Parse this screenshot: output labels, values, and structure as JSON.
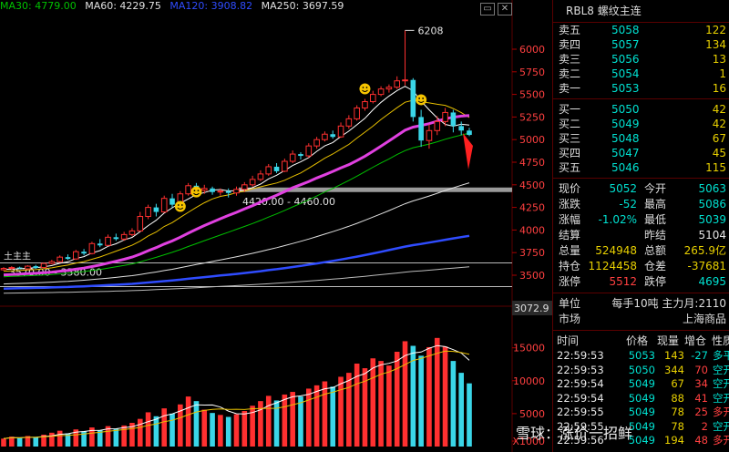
{
  "ma_legend": [
    {
      "label": "MA30: 4779.00",
      "color": "#00c000"
    },
    {
      "label": "MA60: 4229.75",
      "color": "#e0e0e0"
    },
    {
      "label": "MA120: 3908.82",
      "color": "#2f4cff"
    },
    {
      "label": "MA250: 3697.59",
      "color": "#e0e0e0"
    }
  ],
  "window_buttons": {
    "expand": "▭",
    "close": "✕"
  },
  "chart_labels": {
    "high": "6208",
    "band_upper": "4420.00 - 4460.00",
    "band_lower": "3570.00 - 3580.00",
    "price_tag": "3072.9",
    "watermark_left": "土主主"
  },
  "price_axis": [
    "6000",
    "5750",
    "5500",
    "5250",
    "5000",
    "4750",
    "4500",
    "4250",
    "4000",
    "3750",
    "3500"
  ],
  "volume_axis": [
    "15000",
    "10000",
    "5000",
    "X1000"
  ],
  "panel": {
    "title": "RBL8  螺纹主连",
    "asks": [
      {
        "label": "卖五",
        "price": "5058",
        "vol": "122"
      },
      {
        "label": "卖四",
        "price": "5057",
        "vol": "134"
      },
      {
        "label": "卖三",
        "price": "5056",
        "vol": "13"
      },
      {
        "label": "卖二",
        "price": "5054",
        "vol": "1"
      },
      {
        "label": "卖一",
        "price": "5053",
        "vol": "16"
      }
    ],
    "bids": [
      {
        "label": "买一",
        "price": "5050",
        "vol": "42"
      },
      {
        "label": "买二",
        "price": "5049",
        "vol": "42"
      },
      {
        "label": "买三",
        "price": "5048",
        "vol": "67"
      },
      {
        "label": "买四",
        "price": "5047",
        "vol": "45"
      },
      {
        "label": "买五",
        "price": "5046",
        "vol": "115"
      }
    ],
    "quote": [
      {
        "l1": "现价",
        "v1": "5052",
        "c1": "cyan",
        "l2": "今开",
        "v2": "5063",
        "c2": "cyan"
      },
      {
        "l1": "涨跌",
        "v1": "-52",
        "c1": "cyan",
        "l2": "最高",
        "v2": "5086",
        "c2": "cyan"
      },
      {
        "l1": "涨幅",
        "v1": "-1.02%",
        "c1": "cyan",
        "l2": "最低",
        "v2": "5039",
        "c2": "cyan"
      },
      {
        "l1": "结算",
        "v1": "",
        "c1": "white",
        "l2": "昨结",
        "v2": "5104",
        "c2": "white"
      },
      {
        "l1": "总量",
        "v1": "524948",
        "c1": "yellow",
        "l2": "总额",
        "v2": "265.9亿",
        "c2": "yellow"
      },
      {
        "l1": "持仓",
        "v1": "1124458",
        "c1": "yellow",
        "l2": "仓差",
        "v2": "-37681",
        "c2": "yellow"
      },
      {
        "l1": "涨停",
        "v1": "5512",
        "c1": "red",
        "l2": "跌停",
        "v2": "4695",
        "c2": "cyan"
      }
    ],
    "unit": {
      "label": "单位",
      "value": "每手10吨  主力月:2110"
    },
    "market": {
      "label": "市场",
      "value": "上海商品"
    },
    "ticks_header": [
      "时间",
      "价格",
      "现量",
      "增仓",
      "性质"
    ],
    "ticks": [
      {
        "time": "22:59:53",
        "price": "5053",
        "pc": "cyan",
        "vol": "143",
        "chg": "-27",
        "cc": "cyan",
        "nat": "多平",
        "nc": "cyan"
      },
      {
        "time": "22:59:53",
        "price": "5050",
        "pc": "cyan",
        "vol": "344",
        "chg": "70",
        "cc": "red",
        "nat": "空开",
        "nc": "cyan"
      },
      {
        "time": "22:59:54",
        "price": "5049",
        "pc": "cyan",
        "vol": "67",
        "chg": "34",
        "cc": "red",
        "nat": "空开",
        "nc": "cyan"
      },
      {
        "time": "22:59:54",
        "price": "5049",
        "pc": "cyan",
        "vol": "88",
        "chg": "41",
        "cc": "red",
        "nat": "空开",
        "nc": "cyan"
      },
      {
        "time": "22:59:55",
        "price": "5049",
        "pc": "cyan",
        "vol": "78",
        "chg": "25",
        "cc": "red",
        "nat": "多开",
        "nc": "red"
      },
      {
        "time": "22:59:55",
        "price": "5049",
        "pc": "cyan",
        "vol": "78",
        "chg": "2",
        "cc": "red",
        "nat": "空开",
        "nc": "cyan"
      },
      {
        "time": "22:59:56",
        "price": "5049",
        "pc": "cyan",
        "vol": "194",
        "chg": "48",
        "cc": "red",
        "nat": "多开",
        "nc": "red"
      }
    ]
  },
  "watermark": "雪球：涨价一招鲜",
  "chart_data": {
    "type": "candlestick",
    "y_axis": {
      "min": 3500,
      "max": 6000,
      "ticks": [
        3500,
        3750,
        4000,
        4250,
        4500,
        4750,
        5000,
        5250,
        5500,
        5750,
        6000
      ]
    },
    "high_label": 6208,
    "candles": [
      [
        3560,
        3575,
        3550,
        3590
      ],
      [
        3575,
        3585,
        3560,
        3600
      ],
      [
        3585,
        3575,
        3565,
        3595
      ],
      [
        3570,
        3600,
        3560,
        3610
      ],
      [
        3600,
        3580,
        3570,
        3615
      ],
      [
        3585,
        3630,
        3575,
        3640
      ],
      [
        3630,
        3650,
        3620,
        3670
      ],
      [
        3650,
        3700,
        3640,
        3720
      ],
      [
        3700,
        3680,
        3670,
        3730
      ],
      [
        3680,
        3760,
        3670,
        3780
      ],
      [
        3760,
        3740,
        3720,
        3790
      ],
      [
        3740,
        3850,
        3730,
        3870
      ],
      [
        3850,
        3830,
        3810,
        3900
      ],
      [
        3830,
        3920,
        3820,
        3950
      ],
      [
        3920,
        3900,
        3880,
        3960
      ],
      [
        3900,
        3950,
        3880,
        3980
      ],
      [
        3950,
        3990,
        3930,
        4020
      ],
      [
        3990,
        4150,
        3980,
        4200
      ],
      [
        4150,
        4250,
        4120,
        4280
      ],
      [
        4250,
        4200,
        4150,
        4290
      ],
      [
        4200,
        4350,
        4190,
        4380
      ],
      [
        4350,
        4280,
        4250,
        4400
      ],
      [
        4280,
        4400,
        4260,
        4430
      ],
      [
        4400,
        4490,
        4380,
        4520
      ],
      [
        4490,
        4440,
        4420,
        4520
      ],
      [
        4440,
        4460,
        4400,
        4500
      ],
      [
        4460,
        4420,
        4390,
        4480
      ],
      [
        4420,
        4430,
        4380,
        4460
      ],
      [
        4430,
        4410,
        4360,
        4460
      ],
      [
        4410,
        4450,
        4380,
        4480
      ],
      [
        4450,
        4500,
        4420,
        4530
      ],
      [
        4500,
        4560,
        4480,
        4600
      ],
      [
        4560,
        4620,
        4540,
        4660
      ],
      [
        4620,
        4700,
        4600,
        4730
      ],
      [
        4700,
        4650,
        4630,
        4740
      ],
      [
        4650,
        4760,
        4640,
        4790
      ],
      [
        4760,
        4840,
        4740,
        4880
      ],
      [
        4840,
        4820,
        4780,
        4860
      ],
      [
        4820,
        4930,
        4800,
        4960
      ],
      [
        4930,
        5000,
        4900,
        5030
      ],
      [
        5000,
        5060,
        4980,
        5090
      ],
      [
        5060,
        5030,
        5010,
        5100
      ],
      [
        5030,
        5150,
        5020,
        5190
      ],
      [
        5150,
        5230,
        5120,
        5270
      ],
      [
        5230,
        5350,
        5210,
        5380
      ],
      [
        5350,
        5420,
        5320,
        5450
      ],
      [
        5420,
        5500,
        5400,
        5540
      ],
      [
        5500,
        5560,
        5480,
        5590
      ],
      [
        5560,
        5580,
        5520,
        5610
      ],
      [
        5580,
        5650,
        5560,
        5700
      ],
      [
        5650,
        5660,
        5600,
        6208
      ],
      [
        5660,
        5250,
        5200,
        5680
      ],
      [
        5250,
        4990,
        4920,
        5330
      ],
      [
        4990,
        5100,
        4900,
        5170
      ],
      [
        5100,
        5200,
        5050,
        5260
      ],
      [
        5200,
        5300,
        5150,
        5350
      ],
      [
        5300,
        5150,
        5080,
        5330
      ],
      [
        5150,
        5100,
        5050,
        5200
      ],
      [
        5100,
        5052,
        5039,
        5130
      ]
    ],
    "volumes": [
      1200,
      1500,
      1300,
      1600,
      1400,
      1800,
      2100,
      2400,
      2000,
      2600,
      2300,
      2900,
      2500,
      3100,
      2700,
      3200,
      3600,
      4200,
      5200,
      4600,
      5800,
      5000,
      6400,
      7600,
      6900,
      5600,
      5100,
      4800,
      4500,
      4900,
      5400,
      6200,
      6900,
      7700,
      7000,
      7900,
      8300,
      7600,
      8800,
      9300,
      9900,
      9100,
      10600,
      11200,
      12600,
      11900,
      13400,
      13000,
      12300,
      14400,
      16000,
      15300,
      13800,
      15100,
      16500,
      15200,
      13000,
      11200,
      9600
    ],
    "ma_lines": [
      {
        "name": "MA30",
        "color": "#00c000"
      },
      {
        "name": "MA60",
        "color": "#e0e0e0"
      },
      {
        "name": "MA120",
        "color": "#2f4cff"
      },
      {
        "name": "MA250",
        "color": "#e0e0e0"
      }
    ]
  }
}
